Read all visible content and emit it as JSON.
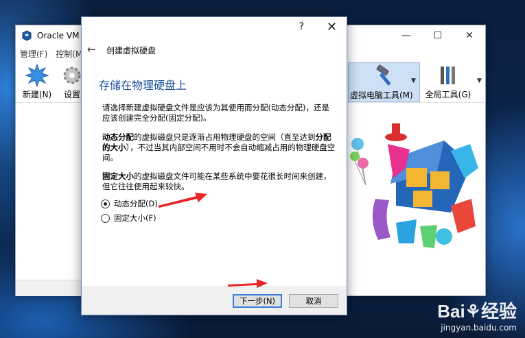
{
  "background_window": {
    "title": "Oracle VM ",
    "menu": [
      "管理(F)",
      "控制(M)"
    ],
    "toolbar": {
      "new_label": "新建(N)",
      "settings_label": "设置",
      "machine_tools_label": "虚拟电脑工具(M)",
      "global_tools_label": "全局工具(G)"
    },
    "window_controls": [
      "—",
      "☐",
      "✕"
    ]
  },
  "dialog": {
    "help_symbol": "?",
    "close_symbol": "✕",
    "back_symbol": "←",
    "title": "创建虚拟硬盘",
    "heading": "存储在物理硬盘上",
    "para1": "请选择新建虚拟硬盘文件是应该为其使用而分配(动态分配)，还是应该创建完全分配(固定分配)。",
    "para2_bold1": "动态分配",
    "para2_text1": "的虚拟磁盘只是逐渐占用物理硬盘的空间（直至达到",
    "para2_bold2": "分配的大小",
    "para2_text2": "），不过当其内部空间不用时不会自动缩减占用的物理硬盘空间。",
    "para3_bold": "固定大小",
    "para3_text": "的虚拟磁盘文件可能在某些系统中要花很长时间来创建，但它往往使用起来较快。",
    "options": [
      {
        "label": "动态分配(D)",
        "selected": true
      },
      {
        "label": "固定大小(F)",
        "selected": false
      }
    ],
    "next_button": "下一步(N)",
    "cancel_button": "取消"
  },
  "watermark": {
    "brand": "Bai⚘经验",
    "url": "jingyan.baidu.com"
  },
  "colors": {
    "heading_blue": "#1c4f9c",
    "annotation_red": "#e8262a",
    "toolbar_active": "#cde0f6"
  }
}
